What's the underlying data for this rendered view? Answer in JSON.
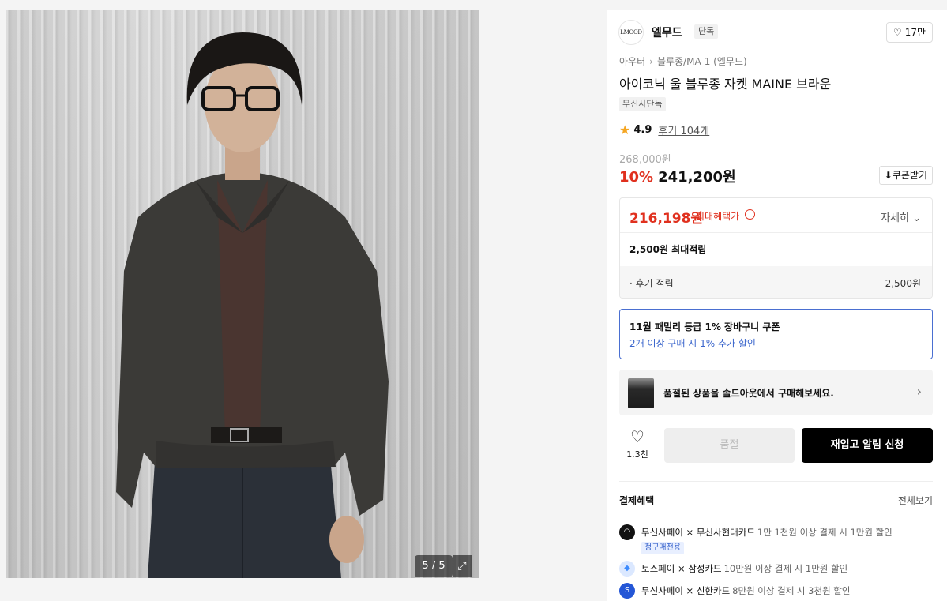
{
  "photo": {
    "counter": "5 / 5",
    "expand_icon": "expand-icon"
  },
  "brand": {
    "logo_text": "LMOOD",
    "name": "엘무드",
    "badge": "단독",
    "likes": "17만"
  },
  "breadcrumb": [
    "아우터",
    "블루종/MA-1 (엘무드)"
  ],
  "product": {
    "title": "아이코닉 울 블루종 자켓 MAINE 브라운",
    "tag": "무신사단독",
    "rating": "4.9",
    "reviews": "후기 104개",
    "original_price": "268,000원",
    "discount": "10%",
    "price": "241,200원",
    "coupon_button": "쿠폰받기"
  },
  "benefit": {
    "max_price": "216,198원",
    "max_label": "최대혜택가",
    "detail_link": "자세히",
    "points": "2,500원 최대적립",
    "review_points_label": "· 후기 적립",
    "review_points_value": "2,500원"
  },
  "coupon_banner": {
    "line1": "11월 패밀리 등급 1% 장바구니 쿠폰",
    "line2": "2개 이상 구매 시 1% 추가 할인"
  },
  "soldout_banner": {
    "text": "품절된 상품을 솔드아웃에서 구매해보세요."
  },
  "actions": {
    "wish_count": "1.3천",
    "soldout_label": "품절",
    "restock_label": "재입고 알림 신청"
  },
  "payment": {
    "title": "결제혜택",
    "view_all": "전체보기",
    "items": [
      {
        "name": "무신사페이 × 무신사현대카드",
        "desc": "1만 1천원 이상 결제 시 1만원 할인",
        "chip": "청구매전용",
        "color": "#111111"
      },
      {
        "name": "토스페이 × 삼성카드",
        "desc": "10만원 이상 결제 시 1만원 할인",
        "color": "#3d8bfd"
      },
      {
        "name": "무신사페이 × 신한카드",
        "desc": "8만원 이상 결제 시 3천원 할인",
        "color": "#2456d6"
      }
    ]
  }
}
